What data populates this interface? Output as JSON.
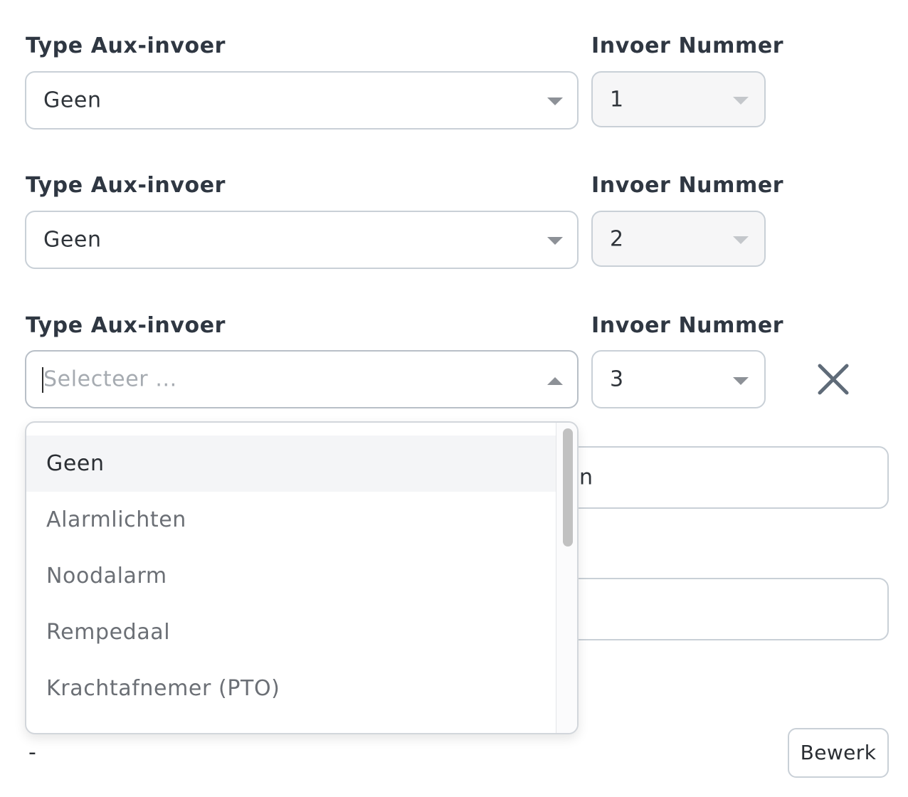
{
  "rows": [
    {
      "type_label": "Type Aux-invoer",
      "number_label": "Invoer Nummer",
      "type_value": "Geen",
      "number_value": "1"
    },
    {
      "type_label": "Type Aux-invoer",
      "number_label": "Invoer Nummer",
      "type_value": "Geen",
      "number_value": "2"
    },
    {
      "type_label": "Type Aux-invoer",
      "number_label": "Invoer Nummer",
      "type_placeholder": "Selecteer ...",
      "number_value": "3"
    }
  ],
  "dropdown": {
    "options": [
      "Geen",
      "Alarmlichten",
      "Noodalarm",
      "Rempedaal",
      "Krachtafnemer (PTO)"
    ],
    "highlighted_index": 0
  },
  "background_field_1": {
    "visible_text": "n"
  },
  "footer": {
    "dash": "-",
    "edit_label": "Bewerk"
  },
  "icons": {
    "close": "close-icon",
    "chevron_down": "chevron-down-icon",
    "chevron_up": "chevron-up-icon"
  },
  "colors": {
    "border": "#c9d0d7",
    "disabled_bg": "#f6f6f7",
    "highlight_bg": "#f4f5f7",
    "close_icon": "#5f6b78"
  }
}
